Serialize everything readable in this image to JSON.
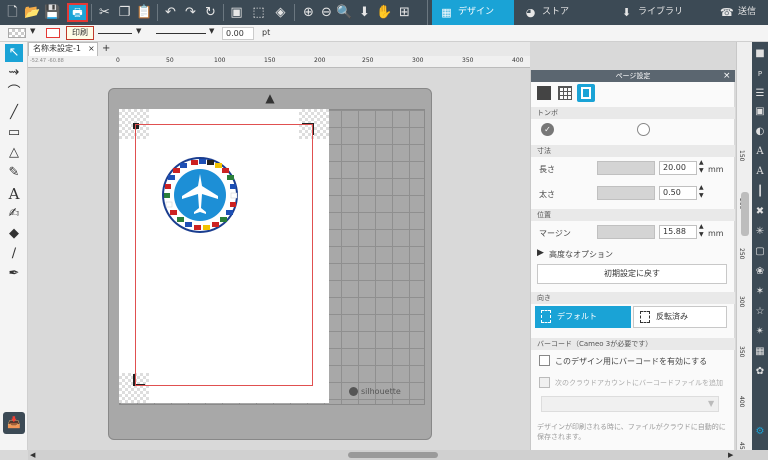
{
  "toolbar": {
    "print_tooltip": "印刷",
    "tabs": [
      {
        "label": "デザイン",
        "icon": "design-grid-icon"
      },
      {
        "label": "ストア",
        "icon": "store-icon"
      },
      {
        "label": "ライブラリ",
        "icon": "library-icon"
      },
      {
        "label": "送信",
        "icon": "send-icon"
      }
    ]
  },
  "toolbar2": {
    "line_width": "0.00",
    "unit": "pt"
  },
  "doc": {
    "tab_label": "名称未設定-1",
    "close": "×",
    "add": "+",
    "ruler_labels": [
      "0",
      "50",
      "100",
      "150",
      "200",
      "250",
      "300",
      "350",
      "400"
    ],
    "ruler_left": "-52.47  -60.88"
  },
  "mat": {
    "brand": "silhouette"
  },
  "v_ruler": [
    "150",
    "200",
    "250",
    "300",
    "350",
    "400",
    "450"
  ],
  "panel": {
    "title": "ページ設定",
    "section_regmarks": "トンボ",
    "section_size": "寸法",
    "length_label": "長さ",
    "length_value": "20.00",
    "length_unit": "mm",
    "thickness_label": "太さ",
    "thickness_value": "0.50",
    "section_position": "位置",
    "margin_label": "マージン",
    "margin_value": "15.88",
    "margin_unit": "mm",
    "advanced_options": "高度なオプション",
    "reset_button": "初期設定に戻す",
    "section_orientation": "向き",
    "default_button": "デフォルト",
    "reversed_button": "反転済み",
    "section_barcode": "バーコード（Cameo 3が必要です）",
    "barcode_enable": "このデザイン用にバーコードを有効にする",
    "barcode_cloud": "次のクラウドアカウントにバーコードファイルを追加",
    "footer_note": "デザインが印刷される時に、ファイルがクラウドに自動的に保存されます。"
  },
  "colors": {
    "accent": "#1aa3d6",
    "toolbar_bg": "#3c4a55",
    "regmark_red": "#e05050"
  }
}
